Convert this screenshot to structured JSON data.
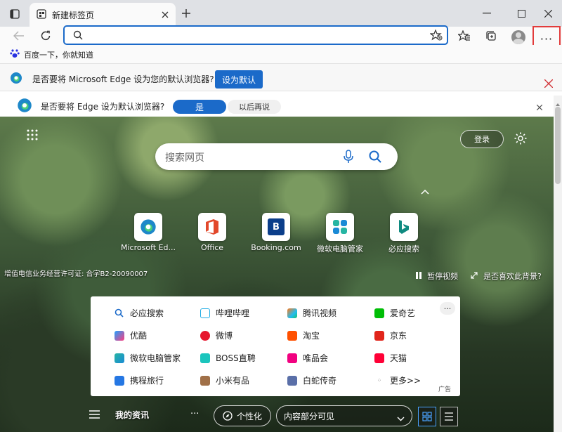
{
  "window": {
    "tab_title": "新建标签页"
  },
  "toolbar": {
    "address_value": ""
  },
  "favorites": {
    "item_label": "百度一下，你就知道"
  },
  "infobar1": {
    "message": "是否要将 Microsoft Edge 设为您的默认浏览器?",
    "button": "设为默认"
  },
  "infobar2": {
    "message": "是否要将 Edge 设为默认浏览器?",
    "yes": "是",
    "later": "以后再说"
  },
  "newtab": {
    "search_placeholder": "搜索网页",
    "login": "登录",
    "license": "增值电信业务经营许可证: 合字B2-20090007",
    "pause_video": "暂停视频",
    "like_bg": "是否喜欢此背景?",
    "quick_links": [
      {
        "label": "Microsoft Ed..."
      },
      {
        "label": "Office"
      },
      {
        "label": "Booking.com"
      },
      {
        "label": "微软电脑管家"
      },
      {
        "label": "必应搜索"
      }
    ],
    "links": [
      [
        "必应搜索",
        "哔哩哔哩",
        "腾讯视频",
        "爱奇艺"
      ],
      [
        "优酷",
        "微博",
        "淘宝",
        "京东"
      ],
      [
        "微软电脑管家",
        "BOSS直聘",
        "唯品会",
        "天猫"
      ],
      [
        "携程旅行",
        "小米有品",
        "白蛇传奇",
        "更多>>"
      ]
    ],
    "ad_label": "广告",
    "bottom": {
      "feed": "我的资讯",
      "personalize": "个性化",
      "content_select": "内容部分可见"
    }
  },
  "colors": {
    "accent": "#1b6ac9",
    "highlight_box": "#e23b3b"
  }
}
